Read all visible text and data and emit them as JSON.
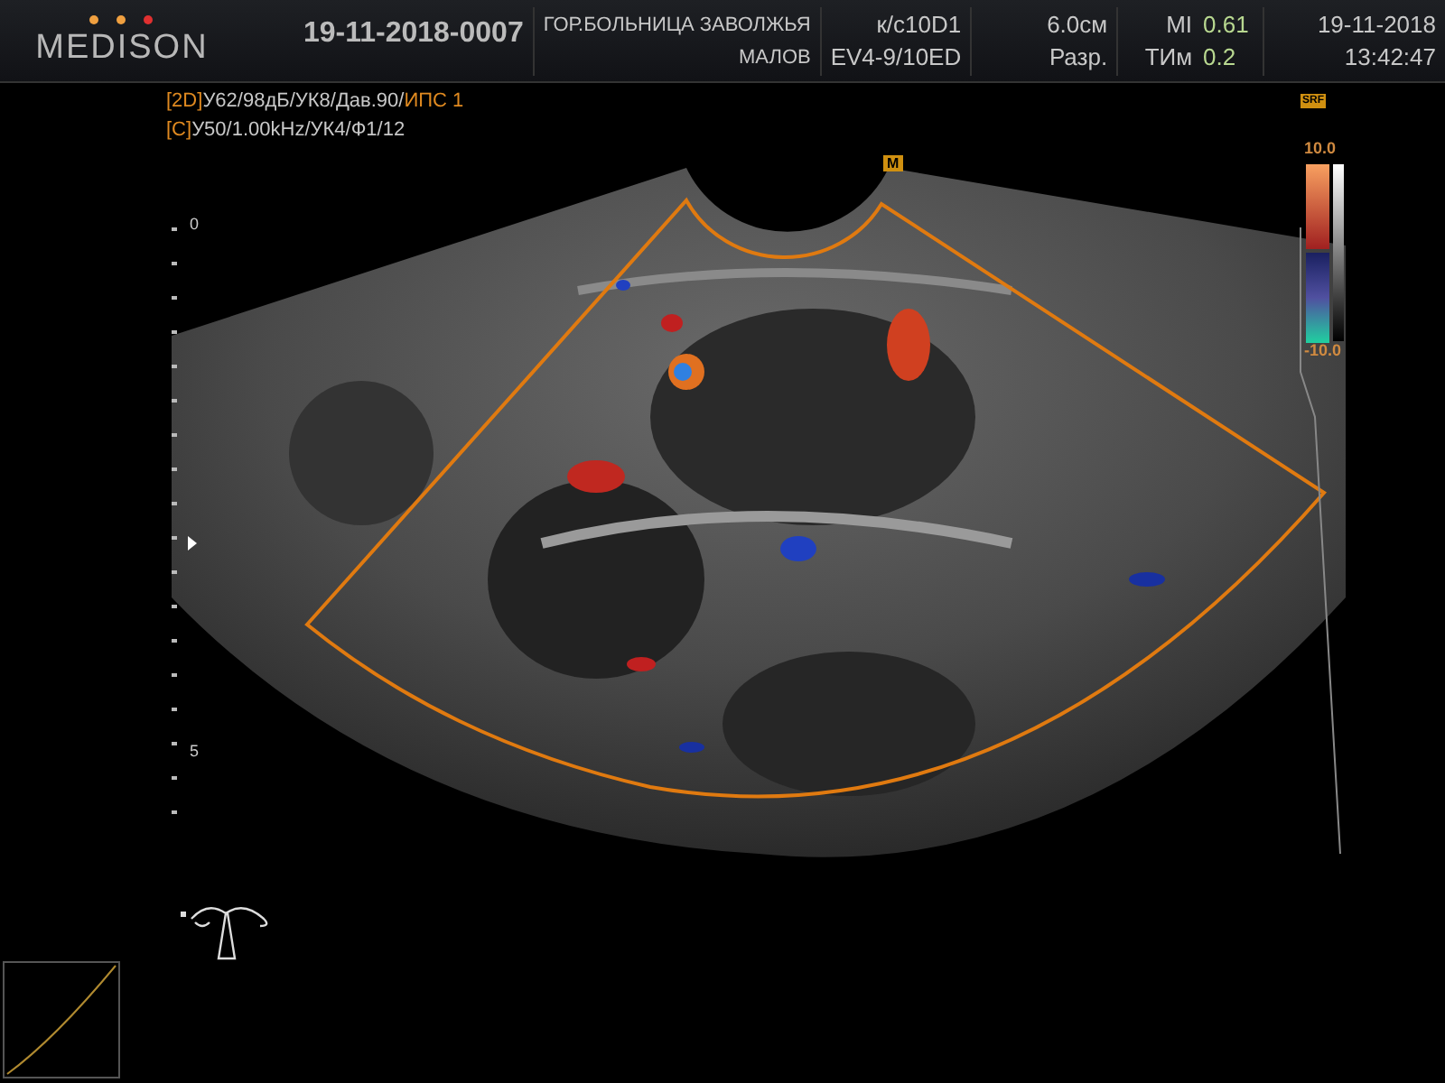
{
  "header": {
    "logo": "MEDISON",
    "patient_id": "19-11-2018-0007",
    "hospital": "ГОР.БОЛЬНИЦА ЗАВОЛЖЬЯ",
    "operator": "МАЛОВ",
    "preset": "к/с10D1",
    "probe": "EV4-9/10ED",
    "depth": "6.0см",
    "resolution": "Разр.",
    "mi_label": "MI",
    "mi_value": "0.61",
    "ti_label": "ТИм",
    "ti_value": "0.2",
    "date": "19-11-2018",
    "time": "13:42:47"
  },
  "params": [
    {
      "mode": "[2D]",
      "text": "У62/98дБ/УК8/Дав.90/",
      "extra": "ИПС 1"
    },
    {
      "mode": "[C]",
      "text": "У50/1.00kHz/УК4/Ф1/12"
    }
  ],
  "depth_scale": [
    "0",
    "5"
  ],
  "color_scale": {
    "max": "10.0",
    "min": "-10.0"
  },
  "srf_badge": "SRF",
  "marker": "M"
}
